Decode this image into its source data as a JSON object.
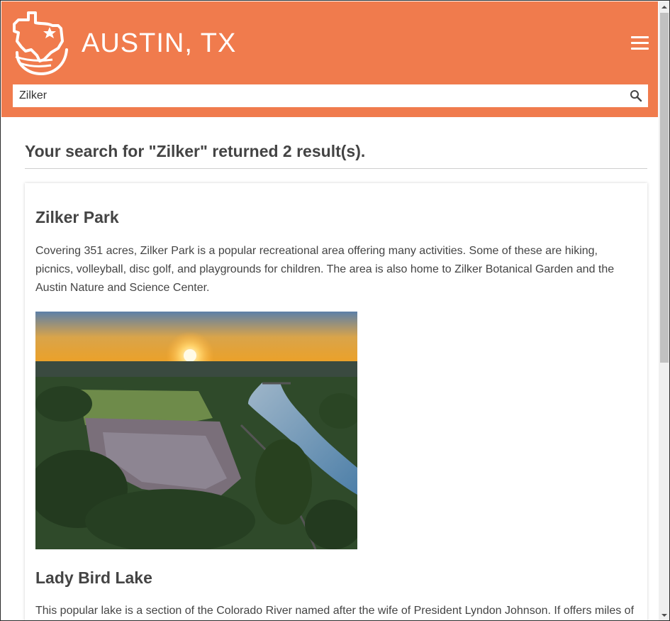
{
  "header": {
    "title": "AUSTIN, TX",
    "logo_icon": "texas-star-logo",
    "menu_icon": "hamburger-menu-icon",
    "accent_color": "#f07b4d"
  },
  "search": {
    "value": "Zilker",
    "icon": "search-icon"
  },
  "results": {
    "heading": "Your search for \"Zilker\" returned 2 result(s).",
    "items": [
      {
        "title": "Zilker Park",
        "description": "Covering 351 acres, Zilker Park is a popular recreational area offering many activities. Some of these are hiking, picnics, volleyball, disc golf, and playgrounds for children. The area is also home to Zilker Botanical Garden and the Austin Nature and Science Center.",
        "image": "aerial-sunset-photo-of-zilker-park-and-river"
      },
      {
        "title": "Lady Bird Lake",
        "description": "This popular lake is a section of the Colorado River named after the wife of President Lyndon Johnson. If offers miles of"
      }
    ]
  }
}
